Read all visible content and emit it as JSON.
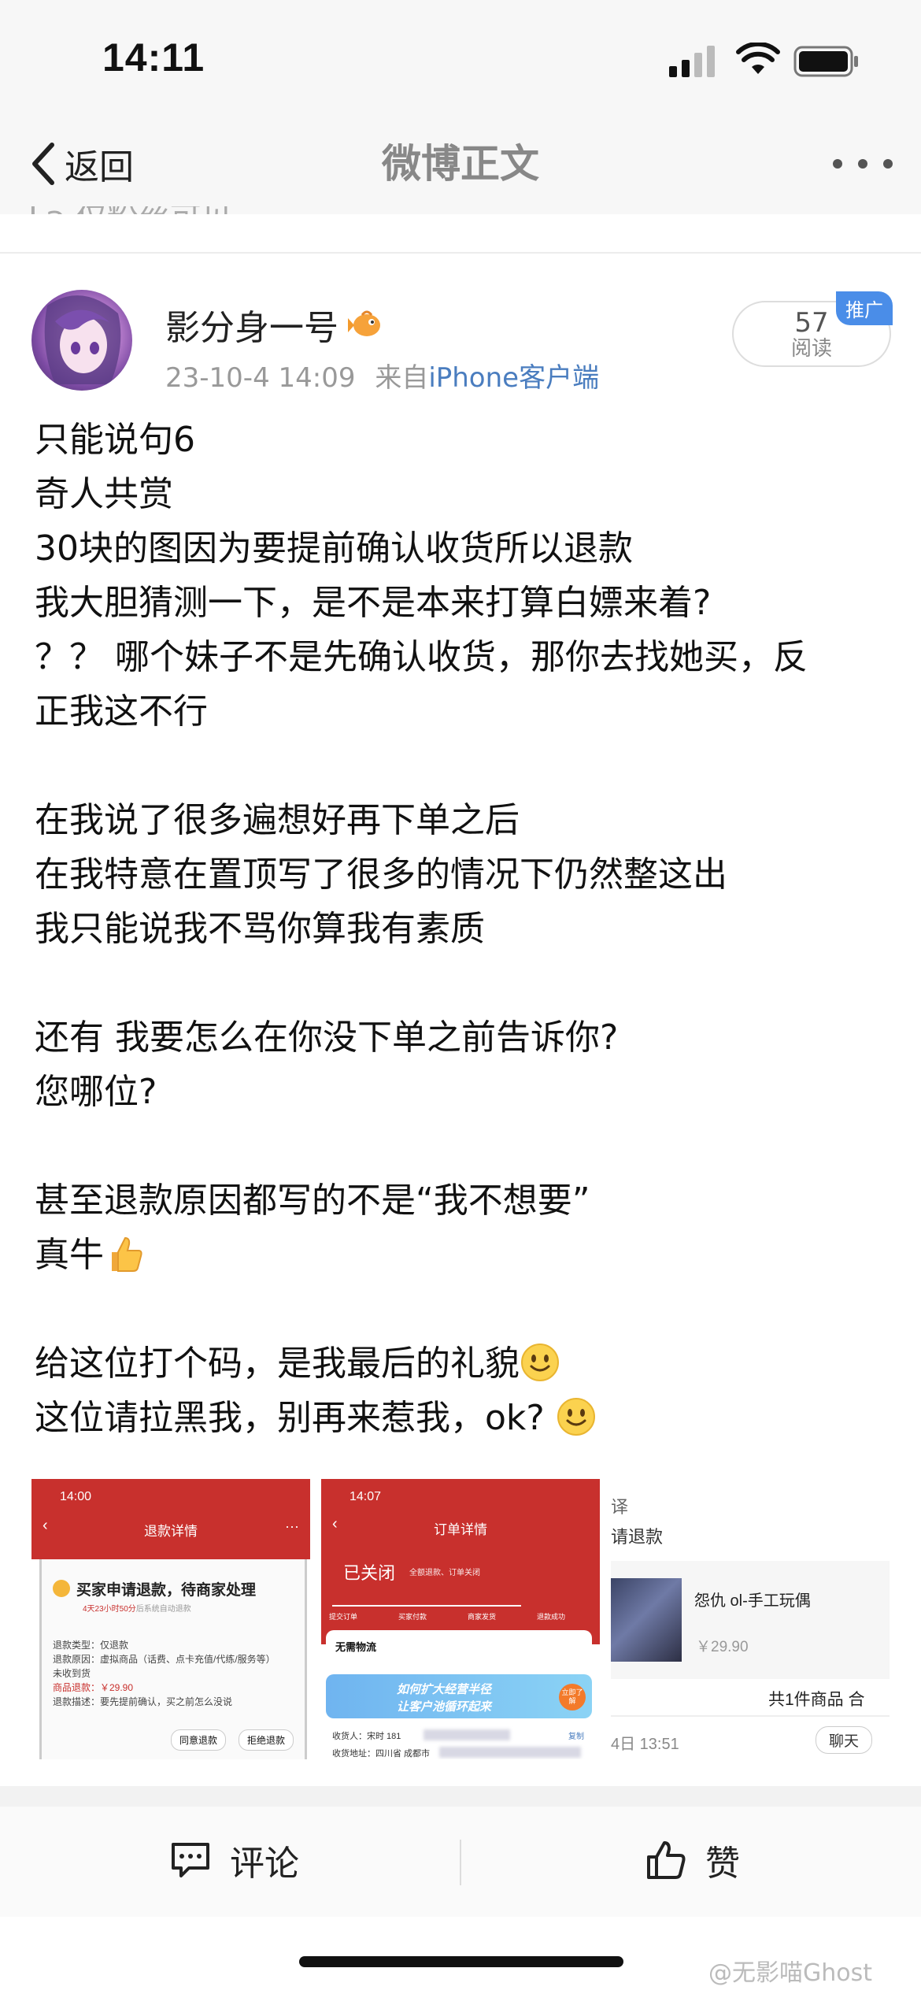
{
  "status_bar": {
    "time": "14:11"
  },
  "nav": {
    "back_label": "返回",
    "title": "微博正文"
  },
  "visibility_note": "仅粉丝可见",
  "author": {
    "name": "影分身一号",
    "timestamp": "23-10-4 14:09",
    "source_prefix": "来自",
    "source": "iPhone客户端"
  },
  "reads": {
    "count": "57",
    "label": "阅读",
    "ad_badge": "推广"
  },
  "post": {
    "lines": [
      "只能说句6",
      "奇人共赏",
      "30块的图因为要提前确认收货所以退款",
      "我大胆猜测一下，是不是本来打算白嫖来着?",
      "？？ 哪个妹子不是先确认收货，那你去找她买，反",
      "正我这不行",
      "",
      "在我说了很多遍想好再下单之后",
      "在我特意在置顶写了很多的情况下仍然整这出",
      "我只能说我不骂你算我有素质",
      "",
      "还有 我要怎么在你没下单之前告诉你?",
      "您哪位?",
      "",
      "甚至退款原因都写的不是“我不想要”",
      "真牛",
      "",
      "给这位打个码，是我最后的礼貌",
      "这位请拉黑我，别再来惹我，ok? "
    ],
    "emojis": {
      "15": "thumbs-up",
      "17": "smile",
      "18": "smile"
    }
  },
  "images": {
    "img1": {
      "time": "14:00",
      "title": "退款详情",
      "status": "买家申请退款，待商家处理",
      "countdown": "4天23小时50分",
      "countdown_suffix": "后系统自动退款",
      "type": "退款类型：仅退款",
      "reason": "退款原因：虚拟商品（话费、点卡充值/代练/服务等）",
      "received": "未收到货",
      "amount": "商品退款：￥29.90",
      "desc": "退款描述：要先提前确认，买之前怎么没说",
      "btn_agree": "同意退款",
      "btn_reject": "拒绝退款"
    },
    "img2": {
      "time": "14:07",
      "title": "订单详情",
      "status": "已关闭",
      "status_sub": "全额退款、订单关闭",
      "steps": [
        "提交订单",
        "买家付款",
        "商家发货",
        "退款成功"
      ],
      "logistics": "无需物流",
      "banner_line1": "如何扩大经营半径",
      "banner_line2": "让客户池循环起来",
      "banner_btn": "立即了解",
      "receiver": "收货人：宋时 181",
      "copy": "复制",
      "address": "收货地址：四川省 成都市"
    },
    "img3": {
      "partial1": "译",
      "partial2": "请退款",
      "product": "怨仇 ol-手工玩偶",
      "price": "￥29.90",
      "total": "共1件商品 合",
      "date": "4日 13:51",
      "chat": "聊天"
    }
  },
  "actions": {
    "comment": "评论",
    "like": "赞"
  },
  "watermark": "@无影喵Ghost",
  "colors": {
    "accent": "#4a7dbf",
    "alipay_red": "#c8302d",
    "ad_badge": "#4a8de8"
  }
}
